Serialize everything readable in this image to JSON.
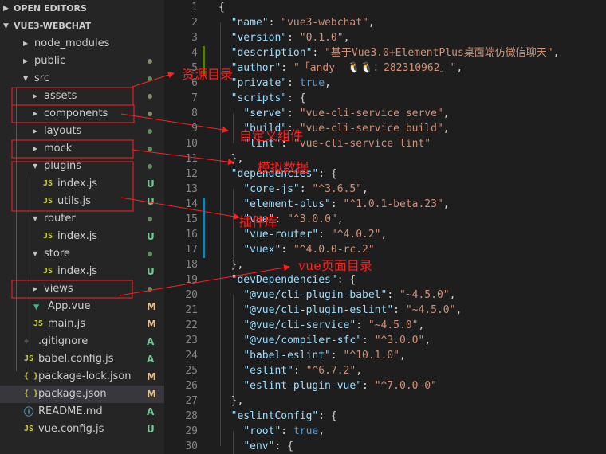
{
  "colors": {
    "sidebar_bg": "#252526",
    "editor_bg": "#1e1e1e",
    "selected_row": "#37373d",
    "js_icon": "#cbcb41",
    "json_icon": "#cbcb41",
    "vue_icon": "#41b883",
    "git_icon": "#41535b",
    "readme_icon": "#519aba",
    "untracked": "#73c991",
    "modified": "#e2c08d",
    "annotation": "#ff2020"
  },
  "sidebar": {
    "open_editors_label": "OPEN EDITORS",
    "project_label": "VUE3-WEBCHAT",
    "items": [
      {
        "label": "node_modules",
        "twisty": "▶",
        "status": ""
      },
      {
        "label": "public",
        "twisty": "▶",
        "status": "dot-mod"
      },
      {
        "label": "src",
        "twisty": "▼",
        "status": "dot-new"
      },
      {
        "label": "assets",
        "twisty": "▶",
        "status": "dot-mod"
      },
      {
        "label": "components",
        "twisty": "▶",
        "status": "dot-mod"
      },
      {
        "label": "layouts",
        "twisty": "▶",
        "status": "dot-new"
      },
      {
        "label": "mock",
        "twisty": "▶",
        "status": "dot-new"
      },
      {
        "label": "plugins",
        "twisty": "▼",
        "status": "dot-new"
      },
      {
        "label": "index.js",
        "icon": "JS",
        "status": "U"
      },
      {
        "label": "utils.js",
        "icon": "JS",
        "status": "U"
      },
      {
        "label": "router",
        "twisty": "▼",
        "status": "dot-new"
      },
      {
        "label": "index.js",
        "icon": "JS",
        "status": "U"
      },
      {
        "label": "store",
        "twisty": "▼",
        "status": "dot-new"
      },
      {
        "label": "index.js",
        "icon": "JS",
        "status": "U"
      },
      {
        "label": "views",
        "twisty": "▶",
        "status": "dot-new"
      },
      {
        "label": "App.vue",
        "icon": "V",
        "status": "M"
      },
      {
        "label": "main.js",
        "icon": "JS",
        "status": "M"
      },
      {
        "label": ".gitignore",
        "icon": "◆",
        "status": "A"
      },
      {
        "label": "babel.config.js",
        "icon": "JS",
        "status": "A"
      },
      {
        "label": "package-lock.json",
        "icon": "{}",
        "status": "M"
      },
      {
        "label": "package.json",
        "icon": "{}",
        "status": "M",
        "selected": true
      },
      {
        "label": "README.md",
        "icon": "ⓘ",
        "status": "A"
      },
      {
        "label": "vue.config.js",
        "icon": "JS",
        "status": "U"
      }
    ]
  },
  "editor": {
    "lines": [
      [
        [
          "{",
          "p"
        ]
      ],
      [
        [
          "  ",
          "p"
        ],
        [
          "\"name\"",
          "k"
        ],
        [
          ": ",
          "p"
        ],
        [
          "\"vue3-webchat\"",
          "s"
        ],
        [
          ",",
          "p"
        ]
      ],
      [
        [
          "  ",
          "p"
        ],
        [
          "\"version\"",
          "k"
        ],
        [
          ": ",
          "p"
        ],
        [
          "\"0.1.0\"",
          "s"
        ],
        [
          ",",
          "p"
        ]
      ],
      [
        [
          "  ",
          "p"
        ],
        [
          "\"description\"",
          "k"
        ],
        [
          ": ",
          "p"
        ],
        [
          "\"基于Vue3.0+ElementPlus桌面端仿微信聊天\"",
          "s"
        ],
        [
          ",",
          "p"
        ]
      ],
      [
        [
          "  ",
          "p"
        ],
        [
          "\"author\"",
          "k"
        ],
        [
          ": ",
          "p"
        ],
        [
          "\"「andy  🐧🐧：282310962」\"",
          "s"
        ],
        [
          ",",
          "p"
        ]
      ],
      [
        [
          "  ",
          "p"
        ],
        [
          "\"private\"",
          "k"
        ],
        [
          ": ",
          "p"
        ],
        [
          "true",
          "b"
        ],
        [
          ",",
          "p"
        ]
      ],
      [
        [
          "  ",
          "p"
        ],
        [
          "\"scripts\"",
          "k"
        ],
        [
          ": {",
          "p"
        ]
      ],
      [
        [
          "    ",
          "p"
        ],
        [
          "\"serve\"",
          "k"
        ],
        [
          ": ",
          "p"
        ],
        [
          "\"vue-cli-service serve\"",
          "s"
        ],
        [
          ",",
          "p"
        ]
      ],
      [
        [
          "    ",
          "p"
        ],
        [
          "\"build\"",
          "k"
        ],
        [
          ": ",
          "p"
        ],
        [
          "\"vue-cli-service build\"",
          "s"
        ],
        [
          ",",
          "p"
        ]
      ],
      [
        [
          "    ",
          "p"
        ],
        [
          "\"lint\"",
          "k"
        ],
        [
          ": ",
          "p"
        ],
        [
          "\"vue-cli-service lint\"",
          "s"
        ]
      ],
      [
        [
          "  },",
          "p"
        ]
      ],
      [
        [
          "  ",
          "p"
        ],
        [
          "\"dependencies\"",
          "k"
        ],
        [
          ": {",
          "p"
        ]
      ],
      [
        [
          "    ",
          "p"
        ],
        [
          "\"core-js\"",
          "k"
        ],
        [
          ": ",
          "p"
        ],
        [
          "\"^3.6.5\"",
          "s"
        ],
        [
          ",",
          "p"
        ]
      ],
      [
        [
          "    ",
          "p"
        ],
        [
          "\"element-plus\"",
          "k"
        ],
        [
          ": ",
          "p"
        ],
        [
          "\"^1.0.1-beta.23\"",
          "s"
        ],
        [
          ",",
          "p"
        ]
      ],
      [
        [
          "    ",
          "p"
        ],
        [
          "\"vue\"",
          "k"
        ],
        [
          ": ",
          "p"
        ],
        [
          "\"^3.0.0\"",
          "s"
        ],
        [
          ",",
          "p"
        ]
      ],
      [
        [
          "    ",
          "p"
        ],
        [
          "\"vue-router\"",
          "k"
        ],
        [
          ": ",
          "p"
        ],
        [
          "\"^4.0.2\"",
          "s"
        ],
        [
          ",",
          "p"
        ]
      ],
      [
        [
          "    ",
          "p"
        ],
        [
          "\"vuex\"",
          "k"
        ],
        [
          ": ",
          "p"
        ],
        [
          "\"^4.0.0-rc.2\"",
          "s"
        ]
      ],
      [
        [
          "  },",
          "p"
        ]
      ],
      [
        [
          "  ",
          "p"
        ],
        [
          "\"devDependencies\"",
          "k"
        ],
        [
          ": {",
          "p"
        ]
      ],
      [
        [
          "    ",
          "p"
        ],
        [
          "\"@vue/cli-plugin-babel\"",
          "k"
        ],
        [
          ": ",
          "p"
        ],
        [
          "\"~4.5.0\"",
          "s"
        ],
        [
          ",",
          "p"
        ]
      ],
      [
        [
          "    ",
          "p"
        ],
        [
          "\"@vue/cli-plugin-eslint\"",
          "k"
        ],
        [
          ": ",
          "p"
        ],
        [
          "\"~4.5.0\"",
          "s"
        ],
        [
          ",",
          "p"
        ]
      ],
      [
        [
          "    ",
          "p"
        ],
        [
          "\"@vue/cli-service\"",
          "k"
        ],
        [
          ": ",
          "p"
        ],
        [
          "\"~4.5.0\"",
          "s"
        ],
        [
          ",",
          "p"
        ]
      ],
      [
        [
          "    ",
          "p"
        ],
        [
          "\"@vue/compiler-sfc\"",
          "k"
        ],
        [
          ": ",
          "p"
        ],
        [
          "\"^3.0.0\"",
          "s"
        ],
        [
          ",",
          "p"
        ]
      ],
      [
        [
          "    ",
          "p"
        ],
        [
          "\"babel-eslint\"",
          "k"
        ],
        [
          ": ",
          "p"
        ],
        [
          "\"^10.1.0\"",
          "s"
        ],
        [
          ",",
          "p"
        ]
      ],
      [
        [
          "    ",
          "p"
        ],
        [
          "\"eslint\"",
          "k"
        ],
        [
          ": ",
          "p"
        ],
        [
          "\"^6.7.2\"",
          "s"
        ],
        [
          ",",
          "p"
        ]
      ],
      [
        [
          "    ",
          "p"
        ],
        [
          "\"eslint-plugin-vue\"",
          "k"
        ],
        [
          ": ",
          "p"
        ],
        [
          "\"^7.0.0-0\"",
          "s"
        ]
      ],
      [
        [
          "  },",
          "p"
        ]
      ],
      [
        [
          "  ",
          "p"
        ],
        [
          "\"eslintConfig\"",
          "k"
        ],
        [
          ": {",
          "p"
        ]
      ],
      [
        [
          "    ",
          "p"
        ],
        [
          "\"root\"",
          "k"
        ],
        [
          ": ",
          "p"
        ],
        [
          "true",
          "b"
        ],
        [
          ",",
          "p"
        ]
      ],
      [
        [
          "    ",
          "p"
        ],
        [
          "\"env\"",
          "k"
        ],
        [
          ": {",
          "p"
        ]
      ]
    ]
  },
  "annotations": [
    {
      "text": "资源目录"
    },
    {
      "text": "自定义组件"
    },
    {
      "text": "模拟数据"
    },
    {
      "text": "插件库"
    },
    {
      "text": "vue页面目录"
    }
  ]
}
